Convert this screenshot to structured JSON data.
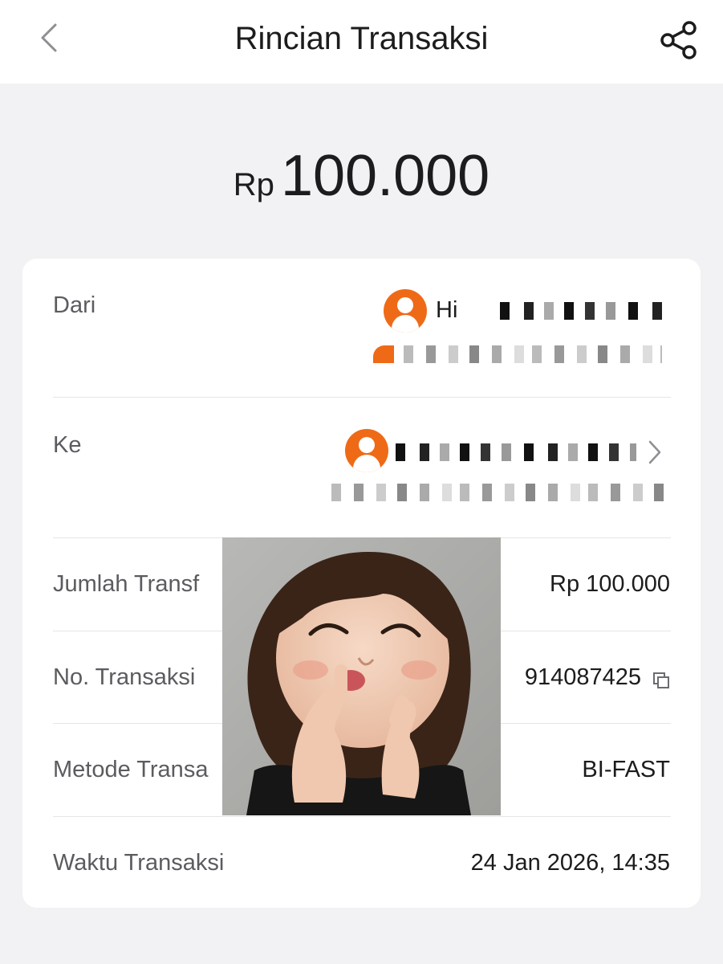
{
  "header": {
    "title": "Rincian Transaksi",
    "back_icon": "chevron-left-icon",
    "share_icon": "share-icon"
  },
  "amount": {
    "currency": "Rp",
    "value": "100.000"
  },
  "details": {
    "from": {
      "label": "Dari",
      "name_visible": "Hi"
    },
    "to": {
      "label": "Ke"
    },
    "transfer_amount": {
      "label": "Jumlah Transf",
      "value": "Rp 100.000"
    },
    "transaction_no": {
      "label": "No. Transaksi",
      "value": "914087425"
    },
    "method": {
      "label": "Metode Transa",
      "value": "BI-FAST"
    },
    "time": {
      "label": "Waktu Transaksi",
      "value": "24 Jan 2026, 14:35"
    }
  },
  "colors": {
    "accent": "#ef6a17",
    "background": "#f2f2f4",
    "card": "#ffffff",
    "label": "#5b5b60",
    "text": "#1c1c1e"
  }
}
